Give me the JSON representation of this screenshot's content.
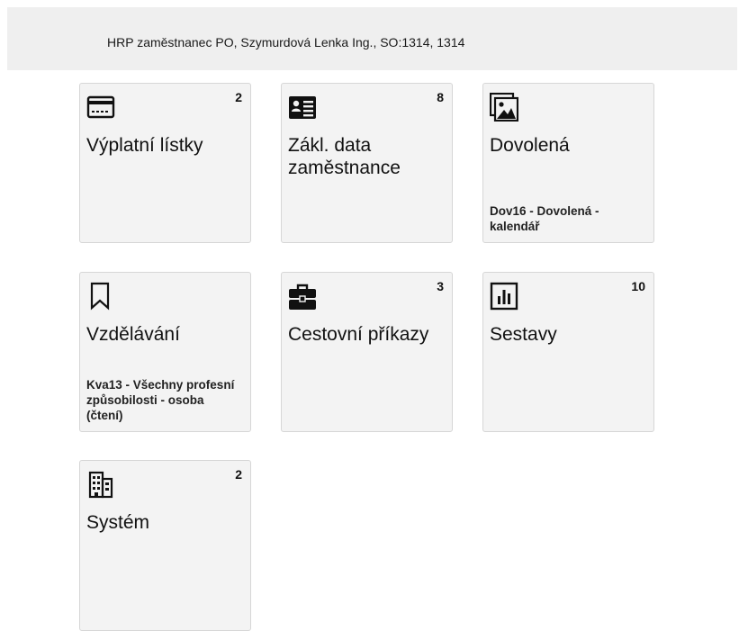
{
  "header": {
    "user_info": "HRP zaměstnanec PO, Szymurdová Lenka Ing., SO:1314, 1314"
  },
  "tiles": [
    {
      "title": "Výplatní lístky",
      "count": "2",
      "subtitle": "",
      "icon": "credit-card-icon"
    },
    {
      "title": "Zákl. data zaměstnance",
      "count": "8",
      "subtitle": "",
      "icon": "id-card-icon"
    },
    {
      "title": "Dovolená",
      "count": "",
      "subtitle": "Dov16 - Dovolená - kalendář",
      "icon": "images-icon"
    },
    {
      "title": "Vzdělávání",
      "count": "",
      "subtitle": "Kva13 - Všechny profesní způsobilosti - osoba (čtení)",
      "icon": "bookmark-icon"
    },
    {
      "title": "Cestovní příkazy",
      "count": "3",
      "subtitle": "",
      "icon": "briefcase-icon"
    },
    {
      "title": "Sestavy",
      "count": "10",
      "subtitle": "",
      "icon": "bar-chart-icon"
    },
    {
      "title": "Systém",
      "count": "2",
      "subtitle": "",
      "icon": "building-icon"
    }
  ]
}
